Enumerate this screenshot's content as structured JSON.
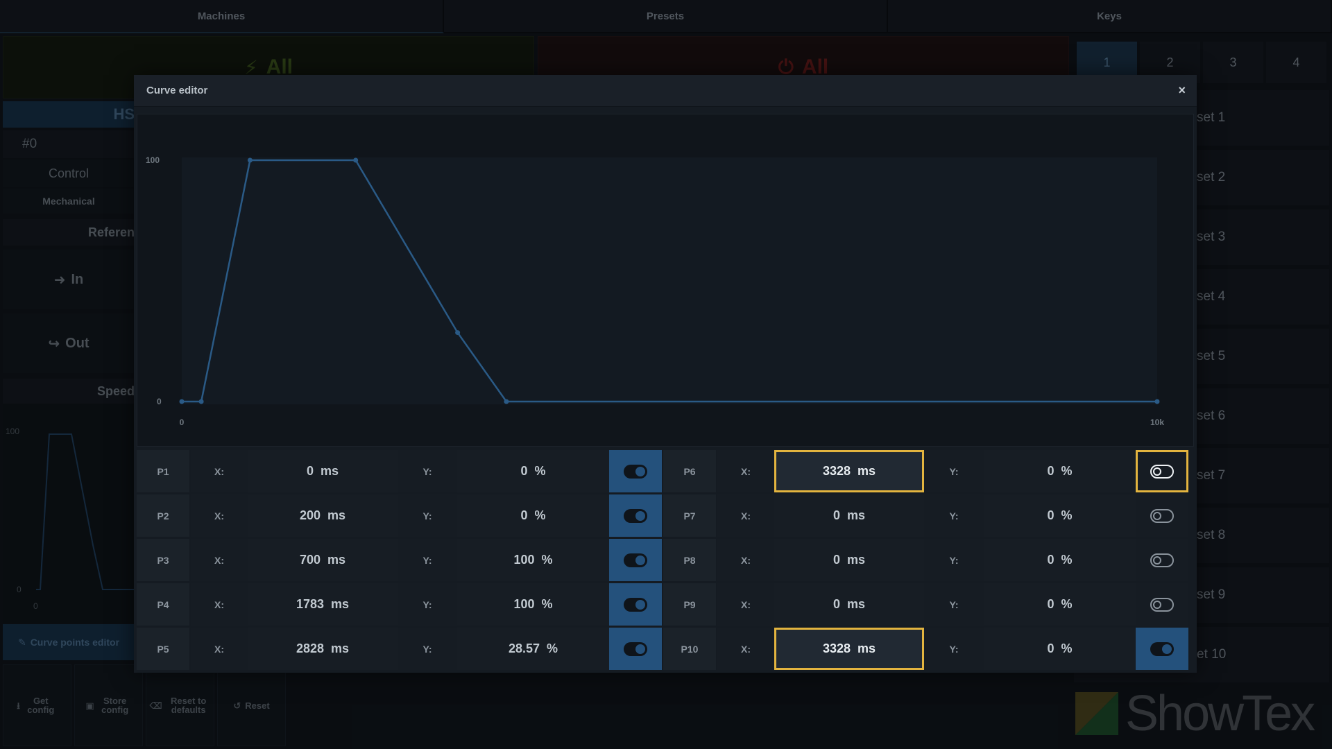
{
  "top_tabs": [
    "Machines",
    "Presets",
    "Keys"
  ],
  "all_on": {
    "label": "All"
  },
  "all_off": {
    "label": "All"
  },
  "number_tabs": [
    "1",
    "2",
    "3",
    "4"
  ],
  "presets": [
    "set 1",
    "set 2",
    "set 3",
    "set 4",
    "set 5",
    "set 6",
    "set 7",
    "set 8",
    "set 9",
    "et 10"
  ],
  "left": {
    "header": "HS",
    "number": "#0",
    "control": "Control",
    "mechanical": "Mechanical",
    "reference": "Referen",
    "in": "In",
    "out": "Out",
    "speed": "Speed",
    "mini_y_max": "100",
    "mini_y_min": "0",
    "mini_x_min": "0",
    "curve_button": "Curve points editor"
  },
  "bottom_buttons": [
    {
      "label": "Get config",
      "icon": "download-icon"
    },
    {
      "label": "Store config",
      "icon": "save-icon"
    },
    {
      "label": "Reset to defaults",
      "icon": "eraser-icon"
    },
    {
      "label": "Reset",
      "icon": "undo-icon"
    }
  ],
  "logo": {
    "text": "ShowTex"
  },
  "modal": {
    "title": "Curve editor",
    "close": "×"
  },
  "chart_data": {
    "type": "line",
    "y_tick_labels": [
      "100",
      "0"
    ],
    "x_tick_labels": [
      "0",
      "10k"
    ],
    "xlim": [
      0,
      10000
    ],
    "ylim": [
      0,
      100
    ],
    "x": [
      0,
      200,
      700,
      1783,
      2828,
      3328,
      10000
    ],
    "y": [
      0,
      0,
      100,
      100,
      28.57,
      0,
      0
    ],
    "color": "#2a5a86"
  },
  "points": {
    "x_label": "X:",
    "y_label": "Y:",
    "x_unit": "ms",
    "y_unit": "%",
    "left": [
      {
        "name": "P1",
        "x": "0",
        "y": "0",
        "enabled": true
      },
      {
        "name": "P2",
        "x": "200",
        "y": "0",
        "enabled": true
      },
      {
        "name": "P3",
        "x": "700",
        "y": "100",
        "enabled": true
      },
      {
        "name": "P4",
        "x": "1783",
        "y": "100",
        "enabled": true
      },
      {
        "name": "P5",
        "x": "2828",
        "y": "28.57",
        "enabled": true
      }
    ],
    "right": [
      {
        "name": "P6",
        "x": "3328",
        "y": "0",
        "enabled": false,
        "selected": true
      },
      {
        "name": "P7",
        "x": "0",
        "y": "0",
        "enabled": false
      },
      {
        "name": "P8",
        "x": "0",
        "y": "0",
        "enabled": false
      },
      {
        "name": "P9",
        "x": "0",
        "y": "0",
        "enabled": false
      },
      {
        "name": "P10",
        "x": "3328",
        "y": "0",
        "enabled": true,
        "selected": true
      }
    ]
  },
  "colors": {
    "accent": "#24517c",
    "highlight": "#e3b43f",
    "line": "#2a5a86"
  }
}
